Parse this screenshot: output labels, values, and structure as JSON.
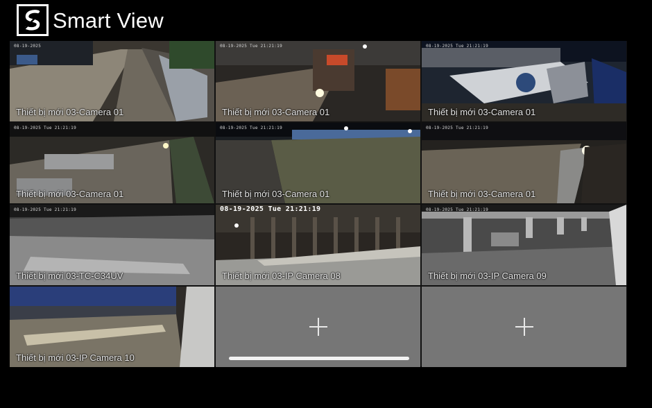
{
  "app": {
    "title": "Smart View"
  },
  "cameras": [
    {
      "label": "Thiết bị mới 03-Camera 01",
      "timestamp": "08-19-2025"
    },
    {
      "label": "Thiết bị mới 03-Camera 01",
      "timestamp": "08-19-2025 Tue 21:21:19"
    },
    {
      "label": "Thiết bị mới 03-Camera 01",
      "timestamp": "08-19-2025 Tue 21:21:19"
    },
    {
      "label": "Thiết bị mới 03-Camera 01",
      "timestamp": "08-19-2025 Tue 21:21:19"
    },
    {
      "label": "Thiết bị mới 03-Camera 01",
      "timestamp": "08-19-2025 Tue 21:21:19"
    },
    {
      "label": "Thiết bị mới 03-Camera 01",
      "timestamp": "08-19-2025 Tue 21:21:19"
    },
    {
      "label": "Thiết bị mới 03-TC-C34UV",
      "timestamp": "08-19-2025 Tue 21:21:19"
    },
    {
      "label": "Thiết bị mới 03-IP Camera 08",
      "timestamp": "08-19-2025 Tue 21:21:19"
    },
    {
      "label": "Thiết bị mới 03-IP Camera 09",
      "timestamp": "08-19-2025 Tue 21:21:19"
    },
    {
      "label": "Thiết bị mới 03-IP Camera 10",
      "timestamp": ""
    }
  ],
  "empty_slots": [
    {
      "icon": "plus-icon"
    },
    {
      "icon": "plus-icon"
    }
  ],
  "colors": {
    "background": "#000000",
    "selected_border": "#c43a3a",
    "empty_slot": "#767676"
  }
}
